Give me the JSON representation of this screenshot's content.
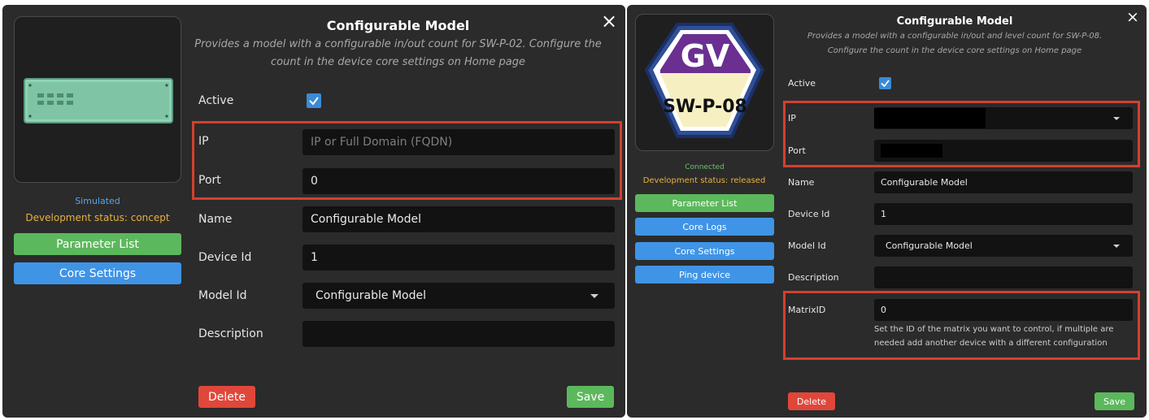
{
  "colors": {
    "panel_bg": "#2b2b2b",
    "field_bg": "#121212",
    "accent_blue": "#3f94e6",
    "accent_green": "#5cb85c",
    "danger_red": "#e0473a",
    "highlight_red": "#d4402e"
  },
  "left_dialog": {
    "title": "Configurable Model",
    "subtitle_line1": "Provides a model with a configurable in/out count for SW-P-02. Configure the",
    "subtitle_line2": "count in the device core settings on Home page",
    "close_icon": "×",
    "status": "Simulated",
    "dev_status": "Development status: concept",
    "buttons": {
      "parameter_list": "Parameter List",
      "core_settings": "Core Settings",
      "delete": "Delete",
      "save": "Save"
    },
    "fields": {
      "active_label": "Active",
      "ip_label": "IP",
      "ip_placeholder": "IP or Full Domain (FQDN)",
      "port_label": "Port",
      "port_value": "0",
      "name_label": "Name",
      "name_value": "Configurable Model",
      "device_id_label": "Device Id",
      "device_id_value": "1",
      "model_id_label": "Model Id",
      "model_id_value": "Configurable Model",
      "description_label": "Description",
      "description_value": ""
    }
  },
  "right_dialog": {
    "title": "Configurable Model",
    "subtitle_line1": "Provides a model with a configurable in/out and level count for SW-P-08.",
    "subtitle_line2": "Configure the count in the device core settings on Home page",
    "close_icon": "×",
    "logo_top": "GV",
    "logo_bottom": "SW-P-08",
    "status": "Connected",
    "dev_status": "Development status: released",
    "buttons": {
      "parameter_list": "Parameter List",
      "core_logs": "Core Logs",
      "core_settings": "Core Settings",
      "ping_device": "Ping device",
      "delete": "Delete",
      "save": "Save"
    },
    "fields": {
      "active_label": "Active",
      "ip_label": "IP",
      "port_label": "Port",
      "name_label": "Name",
      "name_value": "Configurable Model",
      "device_id_label": "Device Id",
      "device_id_value": "1",
      "model_id_label": "Model Id",
      "model_id_value": "Configurable Model",
      "description_label": "Description",
      "description_value": "",
      "matrix_id_label": "MatrixID",
      "matrix_id_value": "0",
      "matrix_help_line1": "Set the ID of the matrix you want to control, if multiple are",
      "matrix_help_line2": "needed add another device with a different configuration"
    }
  }
}
